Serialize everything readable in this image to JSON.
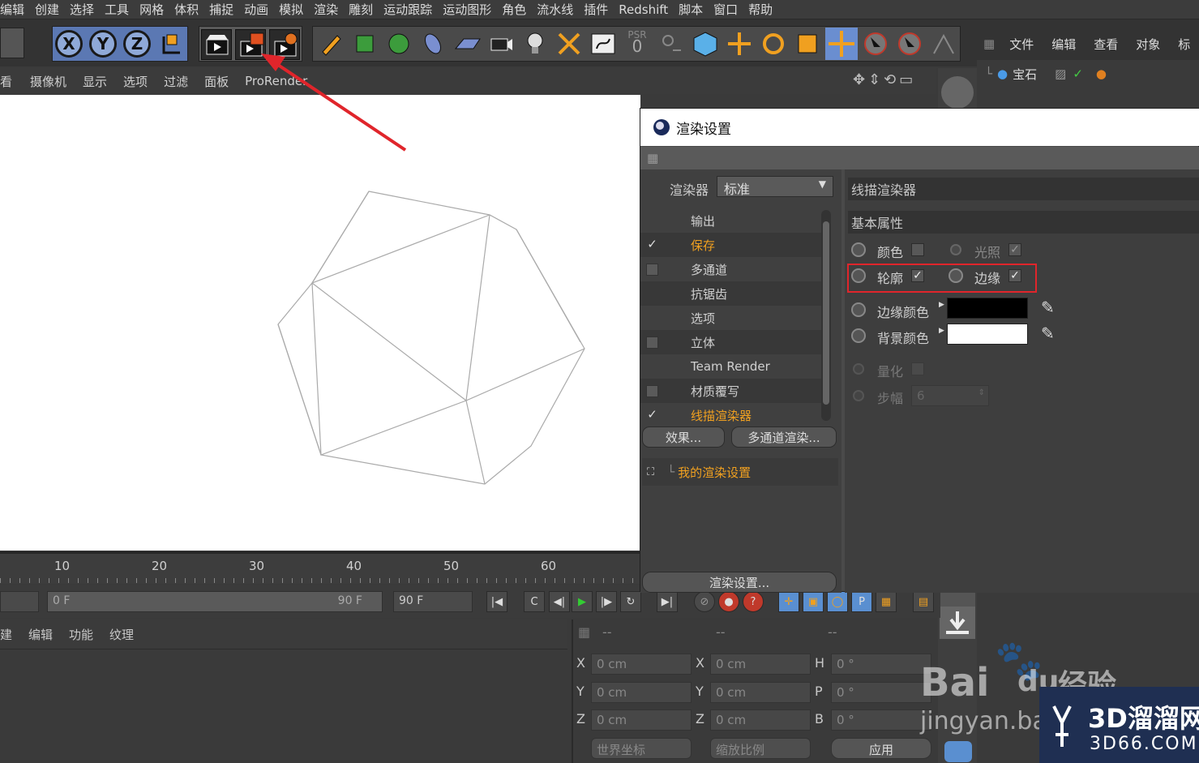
{
  "menubar": {
    "items": [
      "编辑",
      "创建",
      "选择",
      "工具",
      "网格",
      "体积",
      "捕捉",
      "动画",
      "模拟",
      "渲染",
      "雕刻",
      "运动跟踪",
      "运动图形",
      "角色",
      "流水线",
      "插件",
      "Redshift",
      "脚本",
      "窗口",
      "帮助"
    ]
  },
  "toolbar": {
    "axis_x": "X",
    "axis_y": "Y",
    "axis_z": "Z",
    "psr_label": "PSR",
    "psr_value": "0"
  },
  "object_manager": {
    "menu": [
      "文件",
      "编辑",
      "查看",
      "对象",
      "标"
    ],
    "item_label": "宝石"
  },
  "viewport_menu": {
    "items": [
      "看",
      "摄像机",
      "显示",
      "选项",
      "过滤",
      "面板",
      "ProRender"
    ]
  },
  "timeline": {
    "ticks": [
      "10",
      "20",
      "30",
      "40",
      "50",
      "60"
    ]
  },
  "playbar": {
    "start_frame": "0 F",
    "range_end": "90 F",
    "end_frame": "90 F"
  },
  "material_menu": {
    "items": [
      "建",
      "编辑",
      "功能",
      "纹理"
    ]
  },
  "coords": {
    "header_dashes": [
      "--",
      "--",
      "--"
    ],
    "row_labels_a": [
      "X",
      "Y",
      "Z"
    ],
    "row_labels_b": [
      "X",
      "Y",
      "Z"
    ],
    "row_labels_c": [
      "H",
      "P",
      "B"
    ],
    "pos_values": [
      "0 cm",
      "0 cm",
      "0 cm"
    ],
    "size_values": [
      "0 cm",
      "0 cm",
      "0 cm"
    ],
    "rot_values": [
      "0 °",
      "0 °",
      "0 °"
    ],
    "world_coord": "世界坐标",
    "scale_ratio": "缩放比例",
    "apply": "应用"
  },
  "dialog": {
    "title": "渲染设置",
    "renderer_label": "渲染器",
    "renderer_value": "标准",
    "list": [
      {
        "label": "输出",
        "check": "none"
      },
      {
        "label": "保存",
        "check": "checked"
      },
      {
        "label": "多通道",
        "check": "empty"
      },
      {
        "label": "抗锯齿",
        "check": "none"
      },
      {
        "label": "选项",
        "check": "none"
      },
      {
        "label": "立体",
        "check": "empty"
      },
      {
        "label": "Team Render",
        "check": "none"
      },
      {
        "label": "材质覆写",
        "check": "empty"
      },
      {
        "label": "线描渲染器",
        "check": "checked"
      }
    ],
    "effects_button": "效果...",
    "multipass_button": "多通道渲染...",
    "my_settings": "我的渲染设置",
    "render_settings_button": "渲染设置...",
    "right_header": "线描渲染器",
    "section_basic": "基本属性",
    "color_label": "颜色",
    "light_label": "光照",
    "outline_label": "轮廓",
    "edge_label": "边缘",
    "edge_color_label": "边缘颜色",
    "bg_color_label": "背景颜色",
    "quantize_label": "量化",
    "steps_label": "步幅",
    "steps_value": "6",
    "edge_color": "#000000",
    "bg_color": "#ffffff",
    "highlight_color": "#e0252b",
    "accent_orange": "#f0a020"
  },
  "watermark": {
    "baidu": "Bai",
    "du": "du",
    "jingyan": "经验",
    "url": "jingyan.ba",
    "brand": "3D溜溜网",
    "brand_url": "3D66.COM"
  }
}
